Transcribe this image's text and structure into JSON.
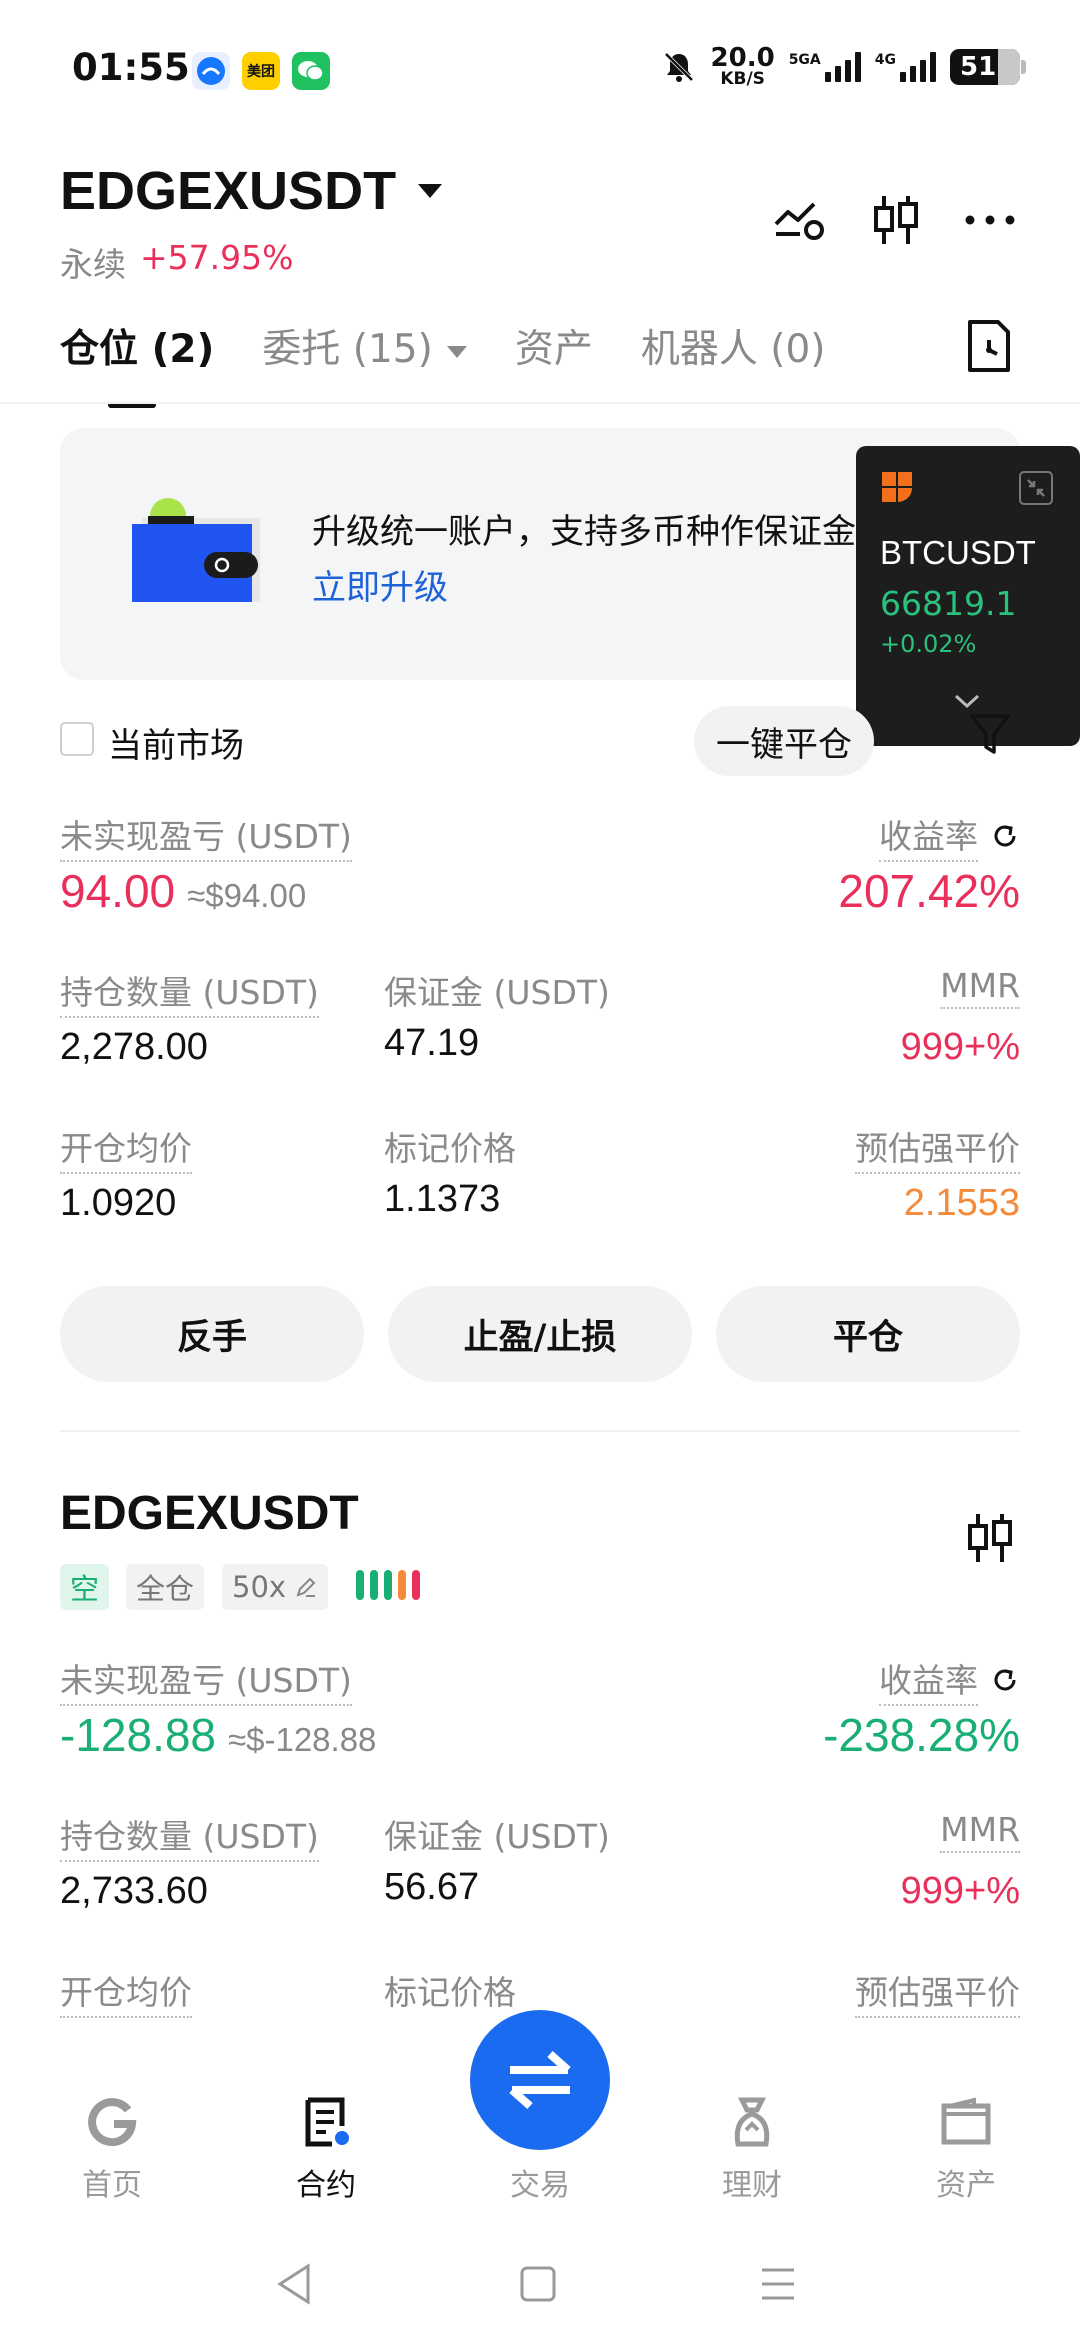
{
  "status_bar": {
    "time": "01:55",
    "app_icons": [
      "alipay-icon",
      "meituan-icon",
      "wechat-icon"
    ],
    "meituan_label": "美团",
    "net_speed_value": "20.0",
    "net_speed_unit": "KB/S",
    "signal1_label": "5GA",
    "signal2_label": "4G",
    "battery": "51"
  },
  "header": {
    "symbol": "EDGEXUSDT",
    "contract_type": "永续",
    "change_pct": "+57.95%"
  },
  "tabs": {
    "positions": "仓位 (2)",
    "orders": "委托 (15)",
    "assets": "资产",
    "bots": "机器人 (0)"
  },
  "banner": {
    "text": "升级统一账户，支持多币种作保证金。",
    "link": "立即升级"
  },
  "floating_ticker": {
    "symbol": "BTCUSDT",
    "price": "66819.1",
    "change": "+0.02%"
  },
  "filter": {
    "current_market": "当前市场",
    "close_all": "一键平仓"
  },
  "position1": {
    "upnl_label": "未实现盈亏 (USDT)",
    "upnl": "94.00",
    "upnl_approx": "≈$94.00",
    "roe_label": "收益率",
    "roe": "207.42%",
    "size_label": "持仓数量 (USDT)",
    "size": "2,278.00",
    "margin_label": "保证金 (USDT)",
    "margin": "47.19",
    "mmr_label": "MMR",
    "mmr": "999+%",
    "entry_label": "开仓均价",
    "entry": "1.0920",
    "mark_label": "标记价格",
    "mark": "1.1373",
    "liq_label": "预估强平价",
    "liq": "2.1553",
    "btn_reverse": "反手",
    "btn_tpsl": "止盈/止损",
    "btn_close": "平仓"
  },
  "position2": {
    "symbol": "EDGEXUSDT",
    "side": "空",
    "margin_mode": "全仓",
    "leverage": "50x",
    "upnl_label": "未实现盈亏 (USDT)",
    "upnl": "-128.88",
    "upnl_approx": "≈$-128.88",
    "roe_label": "收益率",
    "roe": "-238.28%",
    "size_label": "持仓数量 (USDT)",
    "size": "2,733.60",
    "margin_label": "保证金 (USDT)",
    "margin": "56.67",
    "mmr_label": "MMR",
    "mmr": "999+%",
    "entry_label": "开仓均价",
    "mark_label": "标记价格",
    "liq_label": "预估强平价"
  },
  "bottom_nav": {
    "home": "首页",
    "futures": "合约",
    "trade": "交易",
    "earn": "理财",
    "assets": "资产"
  },
  "colors": {
    "red": "#e8305a",
    "green": "#19ae73",
    "orange": "#f48a3a",
    "brand_blue": "#1a6bf0",
    "link_blue": "#1e62d8"
  }
}
